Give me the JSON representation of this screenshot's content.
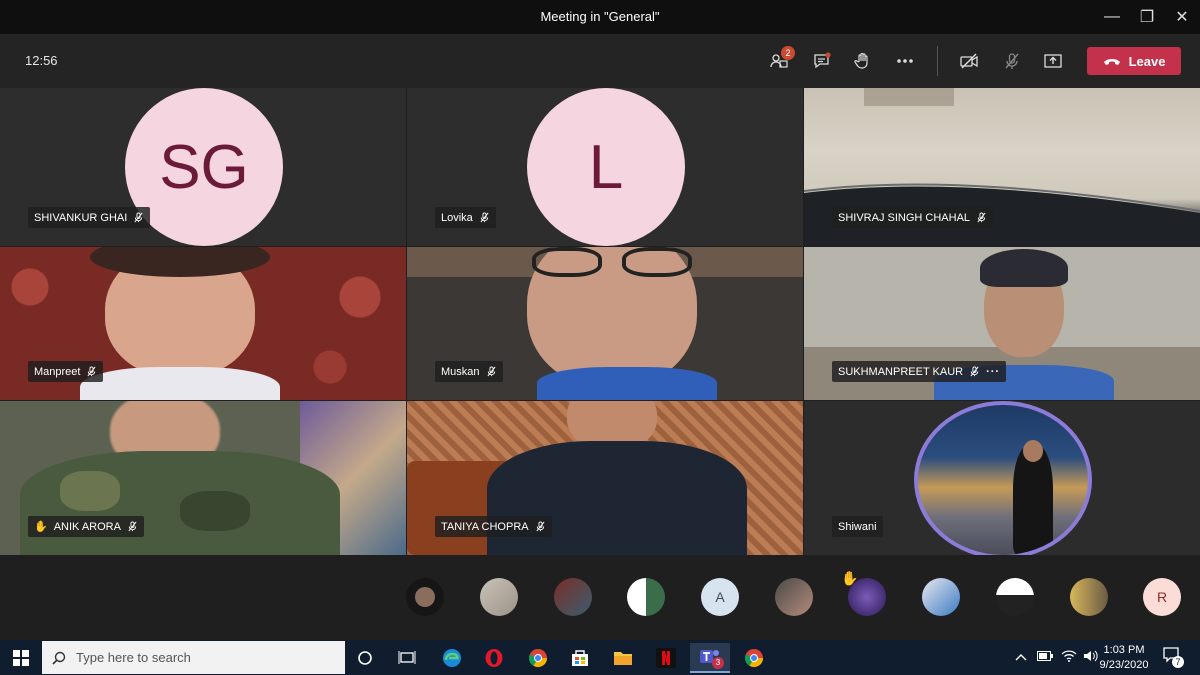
{
  "window": {
    "title": "Meeting in \"General\"",
    "minimize_glyph": "—",
    "restore_glyph": "❐",
    "close_glyph": "✕"
  },
  "toolbar": {
    "clock": "12:56",
    "participants_badge": "2",
    "leave_label": "Leave",
    "leave_color": "#c4314b",
    "icons": [
      "participants-icon",
      "chat-icon",
      "raise-hand-icon",
      "more-options-icon",
      "camera-off-icon",
      "mic-muted-icon",
      "share-screen-icon"
    ]
  },
  "tiles": [
    {
      "name": "SHIVANKUR GHAI",
      "initials": "SG"
    },
    {
      "name": "Lovika",
      "initials": "L"
    },
    {
      "name": "SHIVRAJ SINGH CHAHAL"
    },
    {
      "name": "Manpreet"
    },
    {
      "name": "Muskan"
    },
    {
      "name": "SUKHMANPREET KAUR",
      "more_glyph": "···"
    },
    {
      "name": "ANIK ARORA",
      "hand_glyph": "✋"
    },
    {
      "name": "TANIYA CHOPRA"
    },
    {
      "name": "Shiwani"
    }
  ],
  "roster": {
    "letters": [
      "A",
      "R"
    ],
    "hand_glyph": "✋"
  },
  "taskbar": {
    "search_placeholder": "Type here to search",
    "teams_badge": "3",
    "time": "1:03 PM",
    "date": "9/23/2020",
    "notification_badge": "7",
    "apps": [
      "cortana-icon",
      "task-view-icon",
      "edge-icon",
      "opera-icon",
      "chrome-icon",
      "store-icon",
      "file-explorer-icon",
      "netflix-icon",
      "teams-icon",
      "chrome-profile-icon"
    ]
  },
  "colors": {
    "title_bar": "#0f0f0f",
    "toolbar": "#242424",
    "stage": "#2d2c2c",
    "avatar_bg": "#f5d5df",
    "avatar_text": "#6b1a3a",
    "taskbar": "#0f1d2e"
  }
}
